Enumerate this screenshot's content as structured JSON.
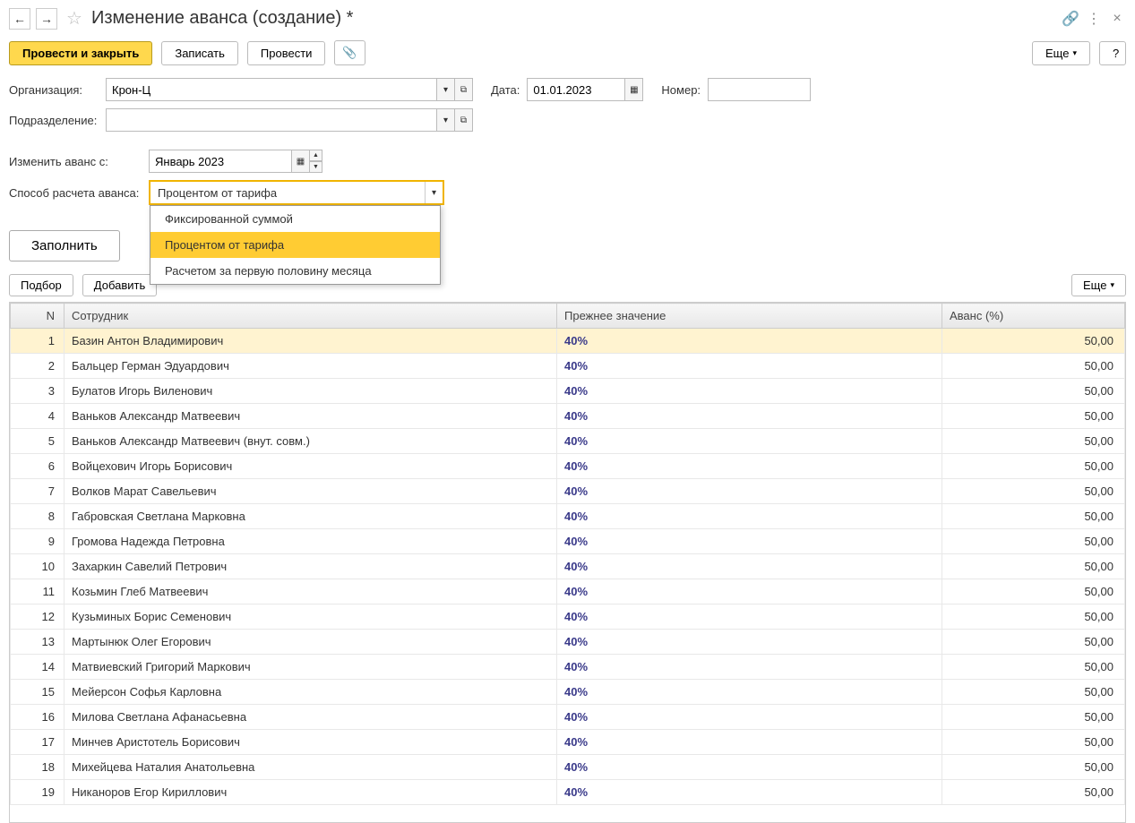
{
  "window": {
    "title": "Изменение аванса (создание) *"
  },
  "toolbar": {
    "postAndClose": "Провести и закрыть",
    "save": "Записать",
    "post": "Провести",
    "more": "Еще",
    "help": "?"
  },
  "labels": {
    "org": "Организация:",
    "date": "Дата:",
    "number": "Номер:",
    "dept": "Подразделение:",
    "changeFrom": "Изменить аванс с:",
    "method": "Способ расчета аванса:"
  },
  "values": {
    "org": "Крон-Ц",
    "date": "01.01.2023",
    "number": "",
    "dept": "",
    "changeFrom": "Январь 2023",
    "method": "Процентом от тарифа"
  },
  "methodOptions": [
    "Фиксированной суммой",
    "Процентом от тарифа",
    "Расчетом за первую половину месяца"
  ],
  "fillBtn": "Заполнить",
  "tableToolbar": {
    "select": "Подбор",
    "add": "Добавить",
    "more": "Еще"
  },
  "table": {
    "headers": {
      "n": "N",
      "employee": "Сотрудник",
      "prev": "Прежнее значение",
      "avans": "Аванс (%)"
    },
    "rows": [
      {
        "n": 1,
        "emp": "Базин Антон Владимирович",
        "prev": "40%",
        "avans": "50,00"
      },
      {
        "n": 2,
        "emp": "Бальцер Герман Эдуардович",
        "prev": "40%",
        "avans": "50,00"
      },
      {
        "n": 3,
        "emp": "Булатов Игорь Виленович",
        "prev": "40%",
        "avans": "50,00"
      },
      {
        "n": 4,
        "emp": "Ваньков Александр Матвеевич",
        "prev": "40%",
        "avans": "50,00"
      },
      {
        "n": 5,
        "emp": "Ваньков Александр Матвеевич (внут. совм.)",
        "prev": "40%",
        "avans": "50,00"
      },
      {
        "n": 6,
        "emp": "Войцехович Игорь Борисович",
        "prev": "40%",
        "avans": "50,00"
      },
      {
        "n": 7,
        "emp": "Волков Марат Савельевич",
        "prev": "40%",
        "avans": "50,00"
      },
      {
        "n": 8,
        "emp": "Габровская Светлана Марковна",
        "prev": "40%",
        "avans": "50,00"
      },
      {
        "n": 9,
        "emp": "Громова Надежда Петровна",
        "prev": "40%",
        "avans": "50,00"
      },
      {
        "n": 10,
        "emp": "Захаркин Савелий Петрович",
        "prev": "40%",
        "avans": "50,00"
      },
      {
        "n": 11,
        "emp": "Козьмин Глеб Матвеевич",
        "prev": "40%",
        "avans": "50,00"
      },
      {
        "n": 12,
        "emp": "Кузьминых Борис Семенович",
        "prev": "40%",
        "avans": "50,00"
      },
      {
        "n": 13,
        "emp": "Мартынюк Олег Егорович",
        "prev": "40%",
        "avans": "50,00"
      },
      {
        "n": 14,
        "emp": "Матвиевский Григорий Маркович",
        "prev": "40%",
        "avans": "50,00"
      },
      {
        "n": 15,
        "emp": "Мейерсон Софья Карловна",
        "prev": "40%",
        "avans": "50,00"
      },
      {
        "n": 16,
        "emp": "Милова Светлана Афанасьевна",
        "prev": "40%",
        "avans": "50,00"
      },
      {
        "n": 17,
        "emp": "Минчев Аристотель Борисович",
        "prev": "40%",
        "avans": "50,00"
      },
      {
        "n": 18,
        "emp": "Михейцева Наталия Анатольевна",
        "prev": "40%",
        "avans": "50,00"
      },
      {
        "n": 19,
        "emp": "Никаноров Егор Кириллович",
        "prev": "40%",
        "avans": "50,00"
      }
    ]
  }
}
